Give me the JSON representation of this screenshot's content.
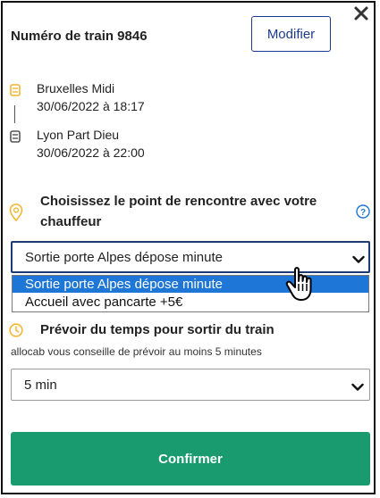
{
  "header": {
    "train_label": "Numéro de train 9846",
    "modify_label": "Modifier"
  },
  "route": {
    "departure": {
      "station": "Bruxelles Midi",
      "datetime": "30/06/2022 à 18:17"
    },
    "arrival": {
      "station": "Lyon Part Dieu",
      "datetime": "30/06/2022 à 22:00"
    }
  },
  "meeting": {
    "question": "Choisissez le point de rencontre avec votre chauffeur",
    "selected": "Sortie porte Alpes dépose minute",
    "options": [
      "Sortie porte Alpes dépose minute",
      "Accueil avec pancarte +5€"
    ]
  },
  "exit_time": {
    "title": "Prévoir du temps pour sortir du train",
    "hint": "allocab vous conseille de prévoir au moins 5 minutes",
    "selected": "5 min"
  },
  "confirm_label": "Confirmer",
  "colors": {
    "accent_blue": "#1d3a8a",
    "option_highlight": "#1e77d6",
    "confirm_green": "#1a9a6f",
    "icon_yellow": "#f2b632"
  },
  "icons": [
    "close-icon",
    "train-start-icon",
    "train-end-icon",
    "location-pin-icon",
    "help-icon",
    "chevron-down-icon",
    "hand-cursor-icon",
    "clock-icon"
  ]
}
